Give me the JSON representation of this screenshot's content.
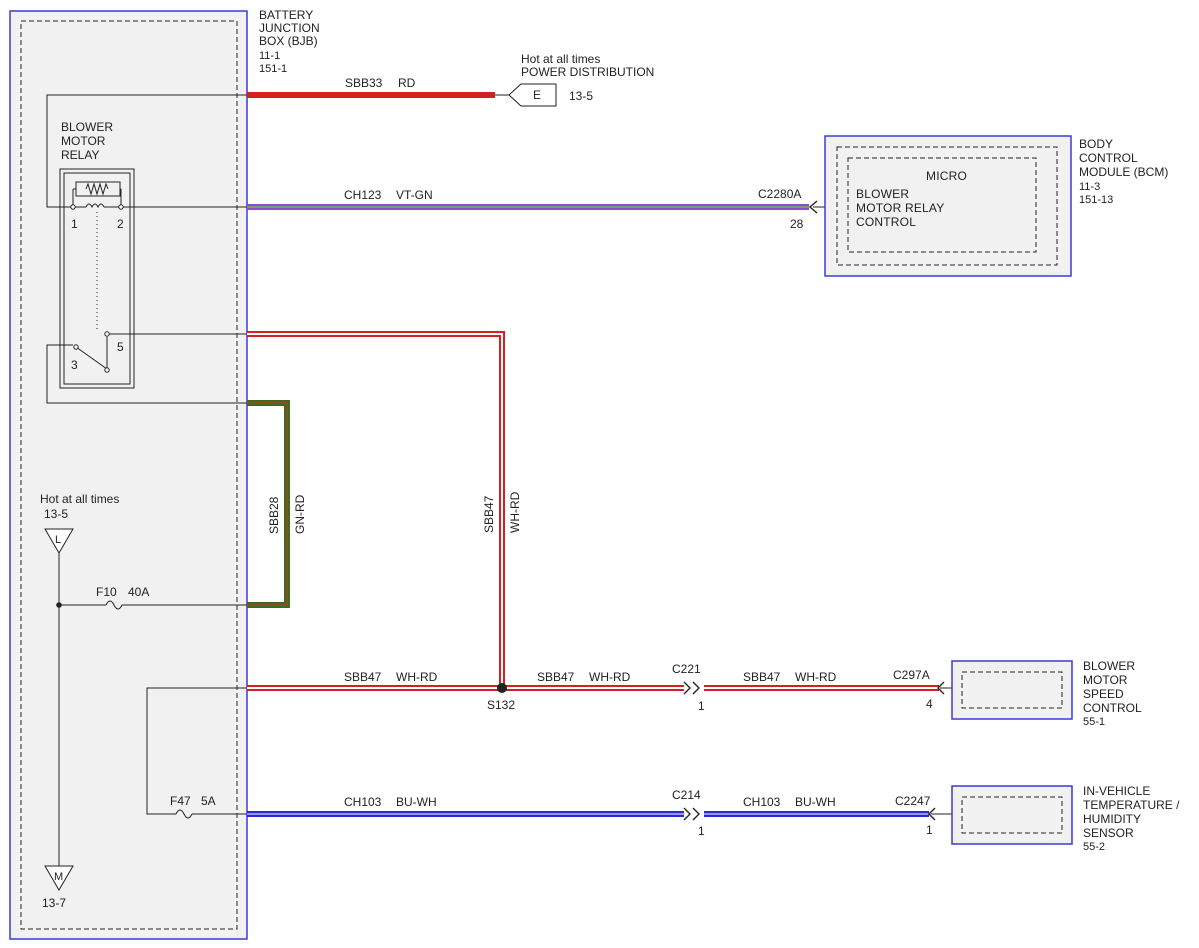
{
  "bjb": {
    "label_lines": [
      "BATTERY",
      "JUNCTION",
      "BOX (BJB)",
      "11-1",
      "151-1"
    ]
  },
  "relay": {
    "label_lines": [
      "BLOWER",
      "MOTOR",
      "RELAY"
    ],
    "pins": {
      "p1": "1",
      "p2": "2",
      "p3": "3",
      "p5": "5"
    }
  },
  "power_dist": {
    "caption_lines": [
      "Hot at all times",
      "POWER DISTRIBUTION"
    ],
    "connector_letter": "E",
    "ref": "13-5"
  },
  "hot_left": {
    "caption": "Hot at all times",
    "ref_top": "13-5",
    "top_letter": "L",
    "bottom_letter": "M",
    "ref_bottom": "13-7"
  },
  "fuses": {
    "f10": {
      "name": "F10",
      "rating": "40A"
    },
    "f47": {
      "name": "F47",
      "rating": "5A"
    }
  },
  "wires": {
    "sbb33": {
      "circuit": "SBB33",
      "color": "RD"
    },
    "ch123": {
      "circuit": "CH123",
      "color": "VT-GN"
    },
    "sbb28": {
      "circuit": "SBB28",
      "color": "GN-RD"
    },
    "sbb47_vertical": {
      "circuit": "SBB47",
      "color": "WH-RD"
    },
    "sbb47_a": {
      "circuit": "SBB47",
      "color": "WH-RD"
    },
    "sbb47_b": {
      "circuit": "SBB47",
      "color": "WH-RD"
    },
    "sbb47_c": {
      "circuit": "SBB47",
      "color": "WH-RD"
    },
    "ch103_a": {
      "circuit": "CH103",
      "color": "BU-WH"
    },
    "ch103_b": {
      "circuit": "CH103",
      "color": "BU-WH"
    }
  },
  "connectors": {
    "c2280a": {
      "name": "C2280A",
      "pin": "28"
    },
    "c221": {
      "name": "C221",
      "pin": "1"
    },
    "c297a": {
      "name": "C297A",
      "pin": "4"
    },
    "c214": {
      "name": "C214",
      "pin": "1"
    },
    "c2247": {
      "name": "C2247",
      "pin": "1"
    }
  },
  "splice": {
    "name": "S132"
  },
  "bcm": {
    "inner_title": "MICRO",
    "inner_lines": [
      "BLOWER",
      "MOTOR RELAY",
      "CONTROL"
    ],
    "label_lines": [
      "BODY",
      "CONTROL",
      "MODULE (BCM)",
      "11-3",
      "151-13"
    ]
  },
  "blower_speed": {
    "label_lines": [
      "BLOWER",
      "MOTOR",
      "SPEED",
      "CONTROL",
      "55-1"
    ]
  },
  "temp_sensor": {
    "label_lines": [
      "IN-VEHICLE",
      "TEMPERATURE /",
      "HUMIDITY",
      "SENSOR",
      "55-2"
    ]
  },
  "colors": {
    "red": "#d42020",
    "green": "#3f6b1d",
    "violet": "#8a4fd0",
    "blue": "#2b2bd6",
    "frame_blue": "#3b3bd6",
    "panel": "#f1f1f1"
  }
}
